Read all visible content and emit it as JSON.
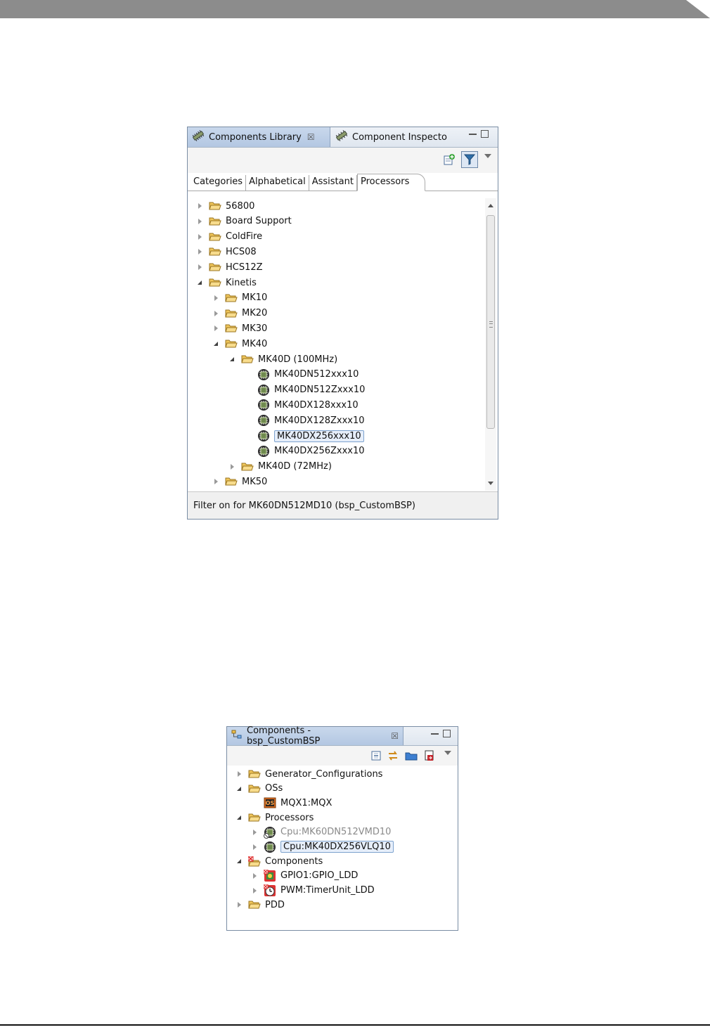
{
  "library_panel": {
    "tabs": [
      {
        "label": "Components Library",
        "icon": "component-library-icon",
        "close": "☒"
      },
      {
        "label": "Component Inspecto",
        "icon": "component-inspector-icon"
      }
    ],
    "toolbar": {
      "buttons": [
        "add-component-icon",
        "filter-icon"
      ],
      "menu": "view-menu-icon"
    },
    "subtabs": [
      "Categories",
      "Alphabetical",
      "Assistant",
      "Processors"
    ],
    "active_subtab": "Processors",
    "tree": [
      {
        "label": "56800",
        "depth": 0,
        "type": "folder",
        "state": "collapsed"
      },
      {
        "label": "Board Support",
        "depth": 0,
        "type": "folder",
        "state": "collapsed"
      },
      {
        "label": "ColdFire",
        "depth": 0,
        "type": "folder",
        "state": "collapsed"
      },
      {
        "label": "HCS08",
        "depth": 0,
        "type": "folder",
        "state": "collapsed"
      },
      {
        "label": "HCS12Z",
        "depth": 0,
        "type": "folder",
        "state": "collapsed"
      },
      {
        "label": "Kinetis",
        "depth": 0,
        "type": "folder",
        "state": "expanded"
      },
      {
        "label": "MK10",
        "depth": 1,
        "type": "folder",
        "state": "collapsed"
      },
      {
        "label": "MK20",
        "depth": 1,
        "type": "folder",
        "state": "collapsed"
      },
      {
        "label": "MK30",
        "depth": 1,
        "type": "folder",
        "state": "collapsed"
      },
      {
        "label": "MK40",
        "depth": 1,
        "type": "folder",
        "state": "expanded"
      },
      {
        "label": "MK40D (100MHz)",
        "depth": 2,
        "type": "folder",
        "state": "expanded"
      },
      {
        "label": "MK40DN512xxx10",
        "depth": 3,
        "type": "cpu",
        "state": "leaf"
      },
      {
        "label": "MK40DN512Zxxx10",
        "depth": 3,
        "type": "cpu",
        "state": "leaf"
      },
      {
        "label": "MK40DX128xxx10",
        "depth": 3,
        "type": "cpu",
        "state": "leaf"
      },
      {
        "label": "MK40DX128Zxxx10",
        "depth": 3,
        "type": "cpu",
        "state": "leaf"
      },
      {
        "label": "MK40DX256xxx10",
        "depth": 3,
        "type": "cpu",
        "state": "leaf",
        "selected": true
      },
      {
        "label": "MK40DX256Zxxx10",
        "depth": 3,
        "type": "cpu",
        "state": "leaf"
      },
      {
        "label": "MK40D (72MHz)",
        "depth": 2,
        "type": "folder",
        "state": "collapsed"
      },
      {
        "label": "MK50",
        "depth": 1,
        "type": "folder",
        "state": "collapsed"
      }
    ],
    "status": "Filter on for MK60DN512MD10 (bsp_CustomBSP)"
  },
  "components_panel": {
    "tab": {
      "label": "Components - bsp_CustomBSP",
      "icon": "components-view-icon",
      "close": "☒"
    },
    "toolbar": {
      "buttons": [
        "collapse-all-icon",
        "link-editor-icon",
        "folder-icon",
        "export-icon"
      ],
      "menu": "view-menu-icon"
    },
    "tree": [
      {
        "label": "Generator_Configurations",
        "depth": 0,
        "type": "folder",
        "state": "collapsed"
      },
      {
        "label": "OSs",
        "depth": 0,
        "type": "folder",
        "state": "expanded"
      },
      {
        "label": "MQX1:MQX",
        "depth": 1,
        "type": "os",
        "state": "leaf"
      },
      {
        "label": "Processors",
        "depth": 0,
        "type": "folder",
        "state": "expanded"
      },
      {
        "label": "Cpu:MK60DN512VMD10",
        "depth": 1,
        "type": "cpu-disabled",
        "state": "collapsed",
        "dim": true
      },
      {
        "label": "Cpu:MK40DX256VLQ10",
        "depth": 1,
        "type": "cpu",
        "state": "collapsed",
        "selected": true
      },
      {
        "label": "Components",
        "depth": 0,
        "type": "folder-error",
        "state": "expanded"
      },
      {
        "label": "GPIO1:GPIO_LDD",
        "depth": 1,
        "type": "component",
        "state": "collapsed"
      },
      {
        "label": "PWM:TimerUnit_LDD",
        "depth": 1,
        "type": "timer",
        "state": "collapsed"
      },
      {
        "label": "PDD",
        "depth": 0,
        "type": "folder",
        "state": "collapsed"
      }
    ]
  }
}
